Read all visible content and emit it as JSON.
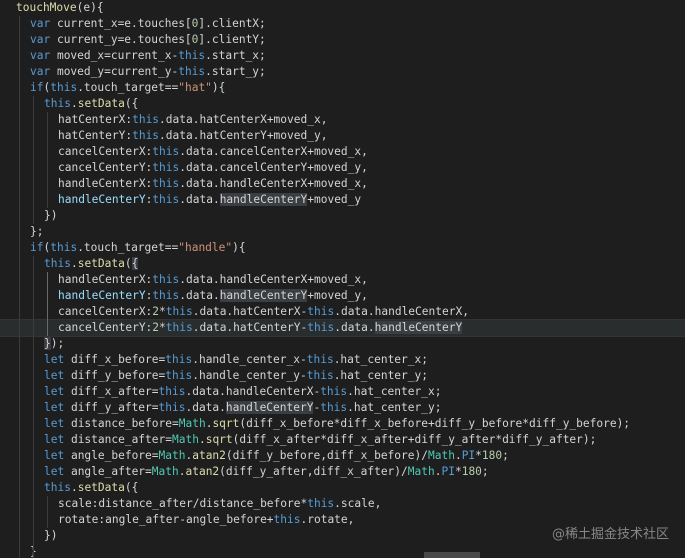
{
  "editor": {
    "lines": [
      {
        "indent": 0,
        "tokens": [
          [
            "fn",
            "touchMove"
          ],
          [
            "punc",
            "(e){"
          ]
        ]
      },
      {
        "indent": 1,
        "tokens": [
          [
            "kw",
            "var"
          ],
          [
            "plain",
            " current_x=e.touches["
          ],
          [
            "num",
            "0"
          ],
          [
            "plain",
            "].clientX;"
          ]
        ]
      },
      {
        "indent": 1,
        "tokens": [
          [
            "kw",
            "var"
          ],
          [
            "plain",
            " current_y=e.touches["
          ],
          [
            "num",
            "0"
          ],
          [
            "plain",
            "].clientY;"
          ]
        ]
      },
      {
        "indent": 1,
        "tokens": [
          [
            "kw",
            "var"
          ],
          [
            "plain",
            " moved_x=current_x-"
          ],
          [
            "kw",
            "this"
          ],
          [
            "plain",
            ".start_x;"
          ]
        ]
      },
      {
        "indent": 1,
        "tokens": [
          [
            "kw",
            "var"
          ],
          [
            "plain",
            " moved_y=current_y-"
          ],
          [
            "kw",
            "this"
          ],
          [
            "plain",
            ".start_y;"
          ]
        ]
      },
      {
        "indent": 1,
        "tokens": [
          [
            "kw",
            "if"
          ],
          [
            "plain",
            "("
          ],
          [
            "kw",
            "this"
          ],
          [
            "plain",
            ".touch_target=="
          ],
          [
            "str",
            "\"hat\""
          ],
          [
            "plain",
            "){"
          ]
        ]
      },
      {
        "indent": 2,
        "tokens": [
          [
            "kw",
            "this"
          ],
          [
            "plain",
            "."
          ],
          [
            "fn",
            "setData"
          ],
          [
            "plain",
            "({"
          ]
        ]
      },
      {
        "indent": 3,
        "tokens": [
          [
            "plain",
            "hatCenterX:"
          ],
          [
            "kw",
            "this"
          ],
          [
            "plain",
            ".data.hatCenterX+moved_x,"
          ]
        ]
      },
      {
        "indent": 3,
        "tokens": [
          [
            "plain",
            "hatCenterY:"
          ],
          [
            "kw",
            "this"
          ],
          [
            "plain",
            ".data.hatCenterY+moved_y,"
          ]
        ]
      },
      {
        "indent": 3,
        "tokens": [
          [
            "plain",
            "cancelCenterX:"
          ],
          [
            "kw",
            "this"
          ],
          [
            "plain",
            ".data.cancelCenterX+moved_x,"
          ]
        ]
      },
      {
        "indent": 3,
        "tokens": [
          [
            "plain",
            "cancelCenterY:"
          ],
          [
            "kw",
            "this"
          ],
          [
            "plain",
            ".data.cancelCenterY+moved_y,"
          ]
        ]
      },
      {
        "indent": 3,
        "tokens": [
          [
            "plain",
            "handleCenterX:"
          ],
          [
            "kw",
            "this"
          ],
          [
            "plain",
            ".data.handleCenterX+moved_x,"
          ]
        ]
      },
      {
        "indent": 3,
        "tokens": [
          [
            "prop",
            "handleCenterY"
          ],
          [
            "plain",
            ":"
          ],
          [
            "kw",
            "this"
          ],
          [
            "plain",
            ".data."
          ],
          [
            "hl",
            "handleCenterY"
          ],
          [
            "plain",
            "+moved_y"
          ]
        ]
      },
      {
        "indent": 2,
        "tokens": [
          [
            "plain",
            "})"
          ]
        ]
      },
      {
        "indent": 1,
        "tokens": [
          [
            "plain",
            "};"
          ]
        ]
      },
      {
        "indent": 1,
        "tokens": [
          [
            "kw",
            "if"
          ],
          [
            "plain",
            "("
          ],
          [
            "kw",
            "this"
          ],
          [
            "plain",
            ".touch_target=="
          ],
          [
            "str",
            "\"handle\""
          ],
          [
            "plain",
            "){"
          ]
        ]
      },
      {
        "indent": 2,
        "tokens": [
          [
            "kw",
            "this"
          ],
          [
            "plain",
            "."
          ],
          [
            "fn",
            "setData"
          ],
          [
            "plain",
            "("
          ],
          [
            "hl",
            "{"
          ]
        ]
      },
      {
        "indent": 3,
        "tokens": [
          [
            "plain",
            "handleCenterX:"
          ],
          [
            "kw",
            "this"
          ],
          [
            "plain",
            ".data.handleCenterX+moved_x,"
          ]
        ]
      },
      {
        "indent": 3,
        "tokens": [
          [
            "prop",
            "handleCenterY"
          ],
          [
            "plain",
            ":"
          ],
          [
            "kw",
            "this"
          ],
          [
            "plain",
            ".data."
          ],
          [
            "hl",
            "handleCenterY"
          ],
          [
            "plain",
            "+moved_y,"
          ]
        ]
      },
      {
        "indent": 3,
        "tokens": [
          [
            "plain",
            "cancelCenterX:"
          ],
          [
            "num",
            "2"
          ],
          [
            "plain",
            "*"
          ],
          [
            "kw",
            "this"
          ],
          [
            "plain",
            ".data.hatCenterX-"
          ],
          [
            "kw",
            "this"
          ],
          [
            "plain",
            ".data.handleCenterX,"
          ]
        ]
      },
      {
        "indent": 3,
        "current": true,
        "tokens": [
          [
            "plain",
            "cancelCenterY:"
          ],
          [
            "num",
            "2"
          ],
          [
            "plain",
            "*"
          ],
          [
            "kw",
            "this"
          ],
          [
            "plain",
            ".data.hatCenterY-"
          ],
          [
            "kw",
            "this"
          ],
          [
            "plain",
            ".data."
          ],
          [
            "hl",
            "handleCenterY"
          ]
        ]
      },
      {
        "indent": 2,
        "tokens": [
          [
            "hl",
            "}"
          ],
          [
            "plain",
            ");"
          ]
        ]
      },
      {
        "indent": 2,
        "tokens": [
          [
            "kw",
            "let"
          ],
          [
            "plain",
            " diff_x_before="
          ],
          [
            "kw",
            "this"
          ],
          [
            "plain",
            ".handle_center_x-"
          ],
          [
            "kw",
            "this"
          ],
          [
            "plain",
            ".hat_center_x;"
          ]
        ]
      },
      {
        "indent": 2,
        "tokens": [
          [
            "kw",
            "let"
          ],
          [
            "plain",
            " diff_y_before="
          ],
          [
            "kw",
            "this"
          ],
          [
            "plain",
            ".handle_center_y-"
          ],
          [
            "kw",
            "this"
          ],
          [
            "plain",
            ".hat_center_y;"
          ]
        ]
      },
      {
        "indent": 2,
        "tokens": [
          [
            "kw",
            "let"
          ],
          [
            "plain",
            " diff_x_after="
          ],
          [
            "kw",
            "this"
          ],
          [
            "plain",
            ".data.handleCenterX-"
          ],
          [
            "kw",
            "this"
          ],
          [
            "plain",
            ".hat_center_x;"
          ]
        ]
      },
      {
        "indent": 2,
        "tokens": [
          [
            "kw",
            "let"
          ],
          [
            "plain",
            " diff_y_after="
          ],
          [
            "kw",
            "this"
          ],
          [
            "plain",
            ".data."
          ],
          [
            "hl",
            "handleCenterY"
          ],
          [
            "plain",
            "-"
          ],
          [
            "kw",
            "this"
          ],
          [
            "plain",
            ".hat_center_y;"
          ]
        ]
      },
      {
        "indent": 2,
        "tokens": [
          [
            "kw",
            "let"
          ],
          [
            "plain",
            " distance_before="
          ],
          [
            "type",
            "Math"
          ],
          [
            "plain",
            "."
          ],
          [
            "fn",
            "sqrt"
          ],
          [
            "plain",
            "(diff_x_before*diff_x_before+diff_y_before*diff_y_before);"
          ]
        ]
      },
      {
        "indent": 2,
        "tokens": [
          [
            "kw",
            "let"
          ],
          [
            "plain",
            " distance_after="
          ],
          [
            "type",
            "Math"
          ],
          [
            "plain",
            "."
          ],
          [
            "fn",
            "sqrt"
          ],
          [
            "plain",
            "(diff_x_after*diff_x_after+diff_y_after*diff_y_after);"
          ]
        ]
      },
      {
        "indent": 2,
        "tokens": [
          [
            "kw",
            "let"
          ],
          [
            "plain",
            " angle_before="
          ],
          [
            "type",
            "Math"
          ],
          [
            "plain",
            "."
          ],
          [
            "fn",
            "atan2"
          ],
          [
            "plain",
            "(diff_y_before,diff_x_before)/"
          ],
          [
            "type",
            "Math"
          ],
          [
            "plain",
            "."
          ],
          [
            "kw",
            "PI"
          ],
          [
            "plain",
            "*"
          ],
          [
            "num",
            "180"
          ],
          [
            "plain",
            ";"
          ]
        ]
      },
      {
        "indent": 2,
        "tokens": [
          [
            "kw",
            "let"
          ],
          [
            "plain",
            " angle_after="
          ],
          [
            "type",
            "Math"
          ],
          [
            "plain",
            "."
          ],
          [
            "fn",
            "atan2"
          ],
          [
            "plain",
            "(diff_y_after,diff_x_after)/"
          ],
          [
            "type",
            "Math"
          ],
          [
            "plain",
            "."
          ],
          [
            "kw",
            "PI"
          ],
          [
            "plain",
            "*"
          ],
          [
            "num",
            "180"
          ],
          [
            "plain",
            ";"
          ]
        ]
      },
      {
        "indent": 2,
        "tokens": [
          [
            "kw",
            "this"
          ],
          [
            "plain",
            "."
          ],
          [
            "fn",
            "setData"
          ],
          [
            "plain",
            "({"
          ]
        ]
      },
      {
        "indent": 3,
        "tokens": [
          [
            "plain",
            "scale:distance_after/distance_before*"
          ],
          [
            "kw",
            "this"
          ],
          [
            "plain",
            ".scale,"
          ]
        ]
      },
      {
        "indent": 3,
        "tokens": [
          [
            "plain",
            "rotate:angle_after-angle_before+"
          ],
          [
            "kw",
            "this"
          ],
          [
            "plain",
            ".rotate,"
          ]
        ]
      },
      {
        "indent": 2,
        "tokens": [
          [
            "plain",
            "})"
          ]
        ]
      },
      {
        "indent": 1,
        "tokens": [
          [
            "plain",
            "}"
          ]
        ]
      }
    ]
  },
  "watermark": "@稀土掘金技术社区",
  "colors": {
    "background": "#1e1e1e",
    "keyword": "#569cd6",
    "function": "#dcdcaa",
    "string": "#ce9178",
    "number": "#b5cea8"
  }
}
